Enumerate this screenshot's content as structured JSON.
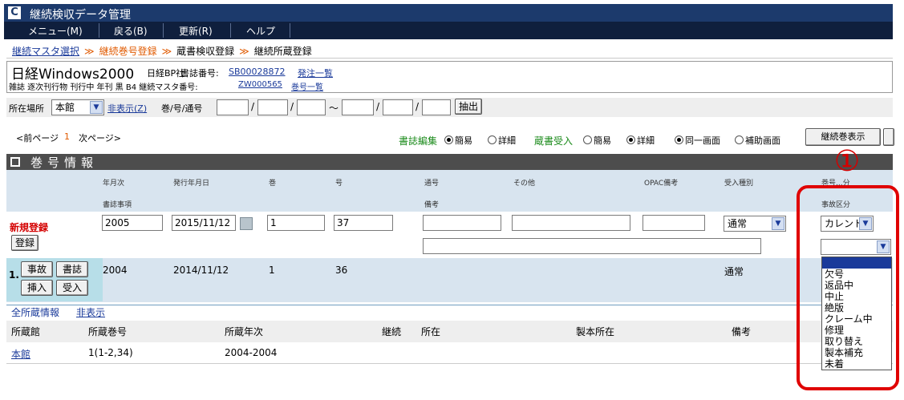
{
  "window": {
    "title": "継続検収データ管理",
    "logo": "C"
  },
  "menu": [
    "メニュー(M)",
    "戻る(B)",
    "更新(R)",
    "ヘルプ"
  ],
  "breadcrumb": {
    "item1": "継続マスタ選択",
    "item2": "継続巻号登録",
    "item3": "蔵書検収登録",
    "item4": "継続所蔵登録",
    "sep": "≫"
  },
  "info": {
    "title": "日経Windows2000",
    "publisher": "日経BP社",
    "book_no_label": "書誌番号:",
    "book_no": "SB00028872",
    "order_link": "発注一覧",
    "line2_prefix": "雑誌 逐次刊行物 刊行中 年刊 黒 B4 継続マスタ番号:",
    "master_no": "ZW000565",
    "volume_link": "巻号一覧"
  },
  "search": {
    "location_label": "所在場所",
    "location_value": "本館",
    "hide_link": "非表示(Z)",
    "vol_label": "巻/号/通号",
    "slash": "/",
    "tilde": "〜",
    "extract_btn": "抽出"
  },
  "paging": {
    "prev": "<前ページ",
    "page": "1",
    "next": "次ページ>"
  },
  "options": {
    "biblio_edit": "書誌編集",
    "simple": "簡易",
    "detail": "詳細",
    "receive": "蔵書受入",
    "same_screen": "同一画面",
    "aux_screen": "補助画面",
    "continue_btn": "継続巻表示"
  },
  "section": {
    "title": "巻号情報"
  },
  "columns": {
    "row1": [
      "年月次",
      "発行年月日",
      "巻",
      "号",
      "通号",
      "その他",
      "OPAC備考",
      "受入種別",
      "巻号...分"
    ],
    "row2": [
      "書誌事項",
      "備考",
      "事故区分"
    ]
  },
  "new_entry": {
    "label": "新規登録",
    "register_btn": "登録",
    "year": "2005",
    "date": "2015/11/12",
    "vol": "1",
    "no": "37",
    "receive_type": "通常",
    "accident_type": "カレント"
  },
  "record": {
    "index": "1.",
    "buttons": [
      "事故",
      "書誌",
      "挿入",
      "受入"
    ],
    "year": "2004",
    "date": "2014/11/12",
    "vol": "1",
    "no": "36",
    "receive_type": "通常"
  },
  "holdings": {
    "title": "全所蔵情報",
    "hide_link": "非表示",
    "headers": [
      "所蔵館",
      "所蔵巻号",
      "所蔵年次",
      "継続",
      "所在",
      "製本所在",
      "備考"
    ],
    "row": {
      "library": "本館",
      "volumes": "1(1-2,34)",
      "years": "2004-2004"
    }
  },
  "dropdown_options": [
    "欠号",
    "返品中",
    "中止",
    "絶版",
    "クレーム中",
    "修理",
    "取り替え",
    "製本補充",
    "未着"
  ],
  "annotation": {
    "number": "①",
    "color": "#e00000"
  }
}
